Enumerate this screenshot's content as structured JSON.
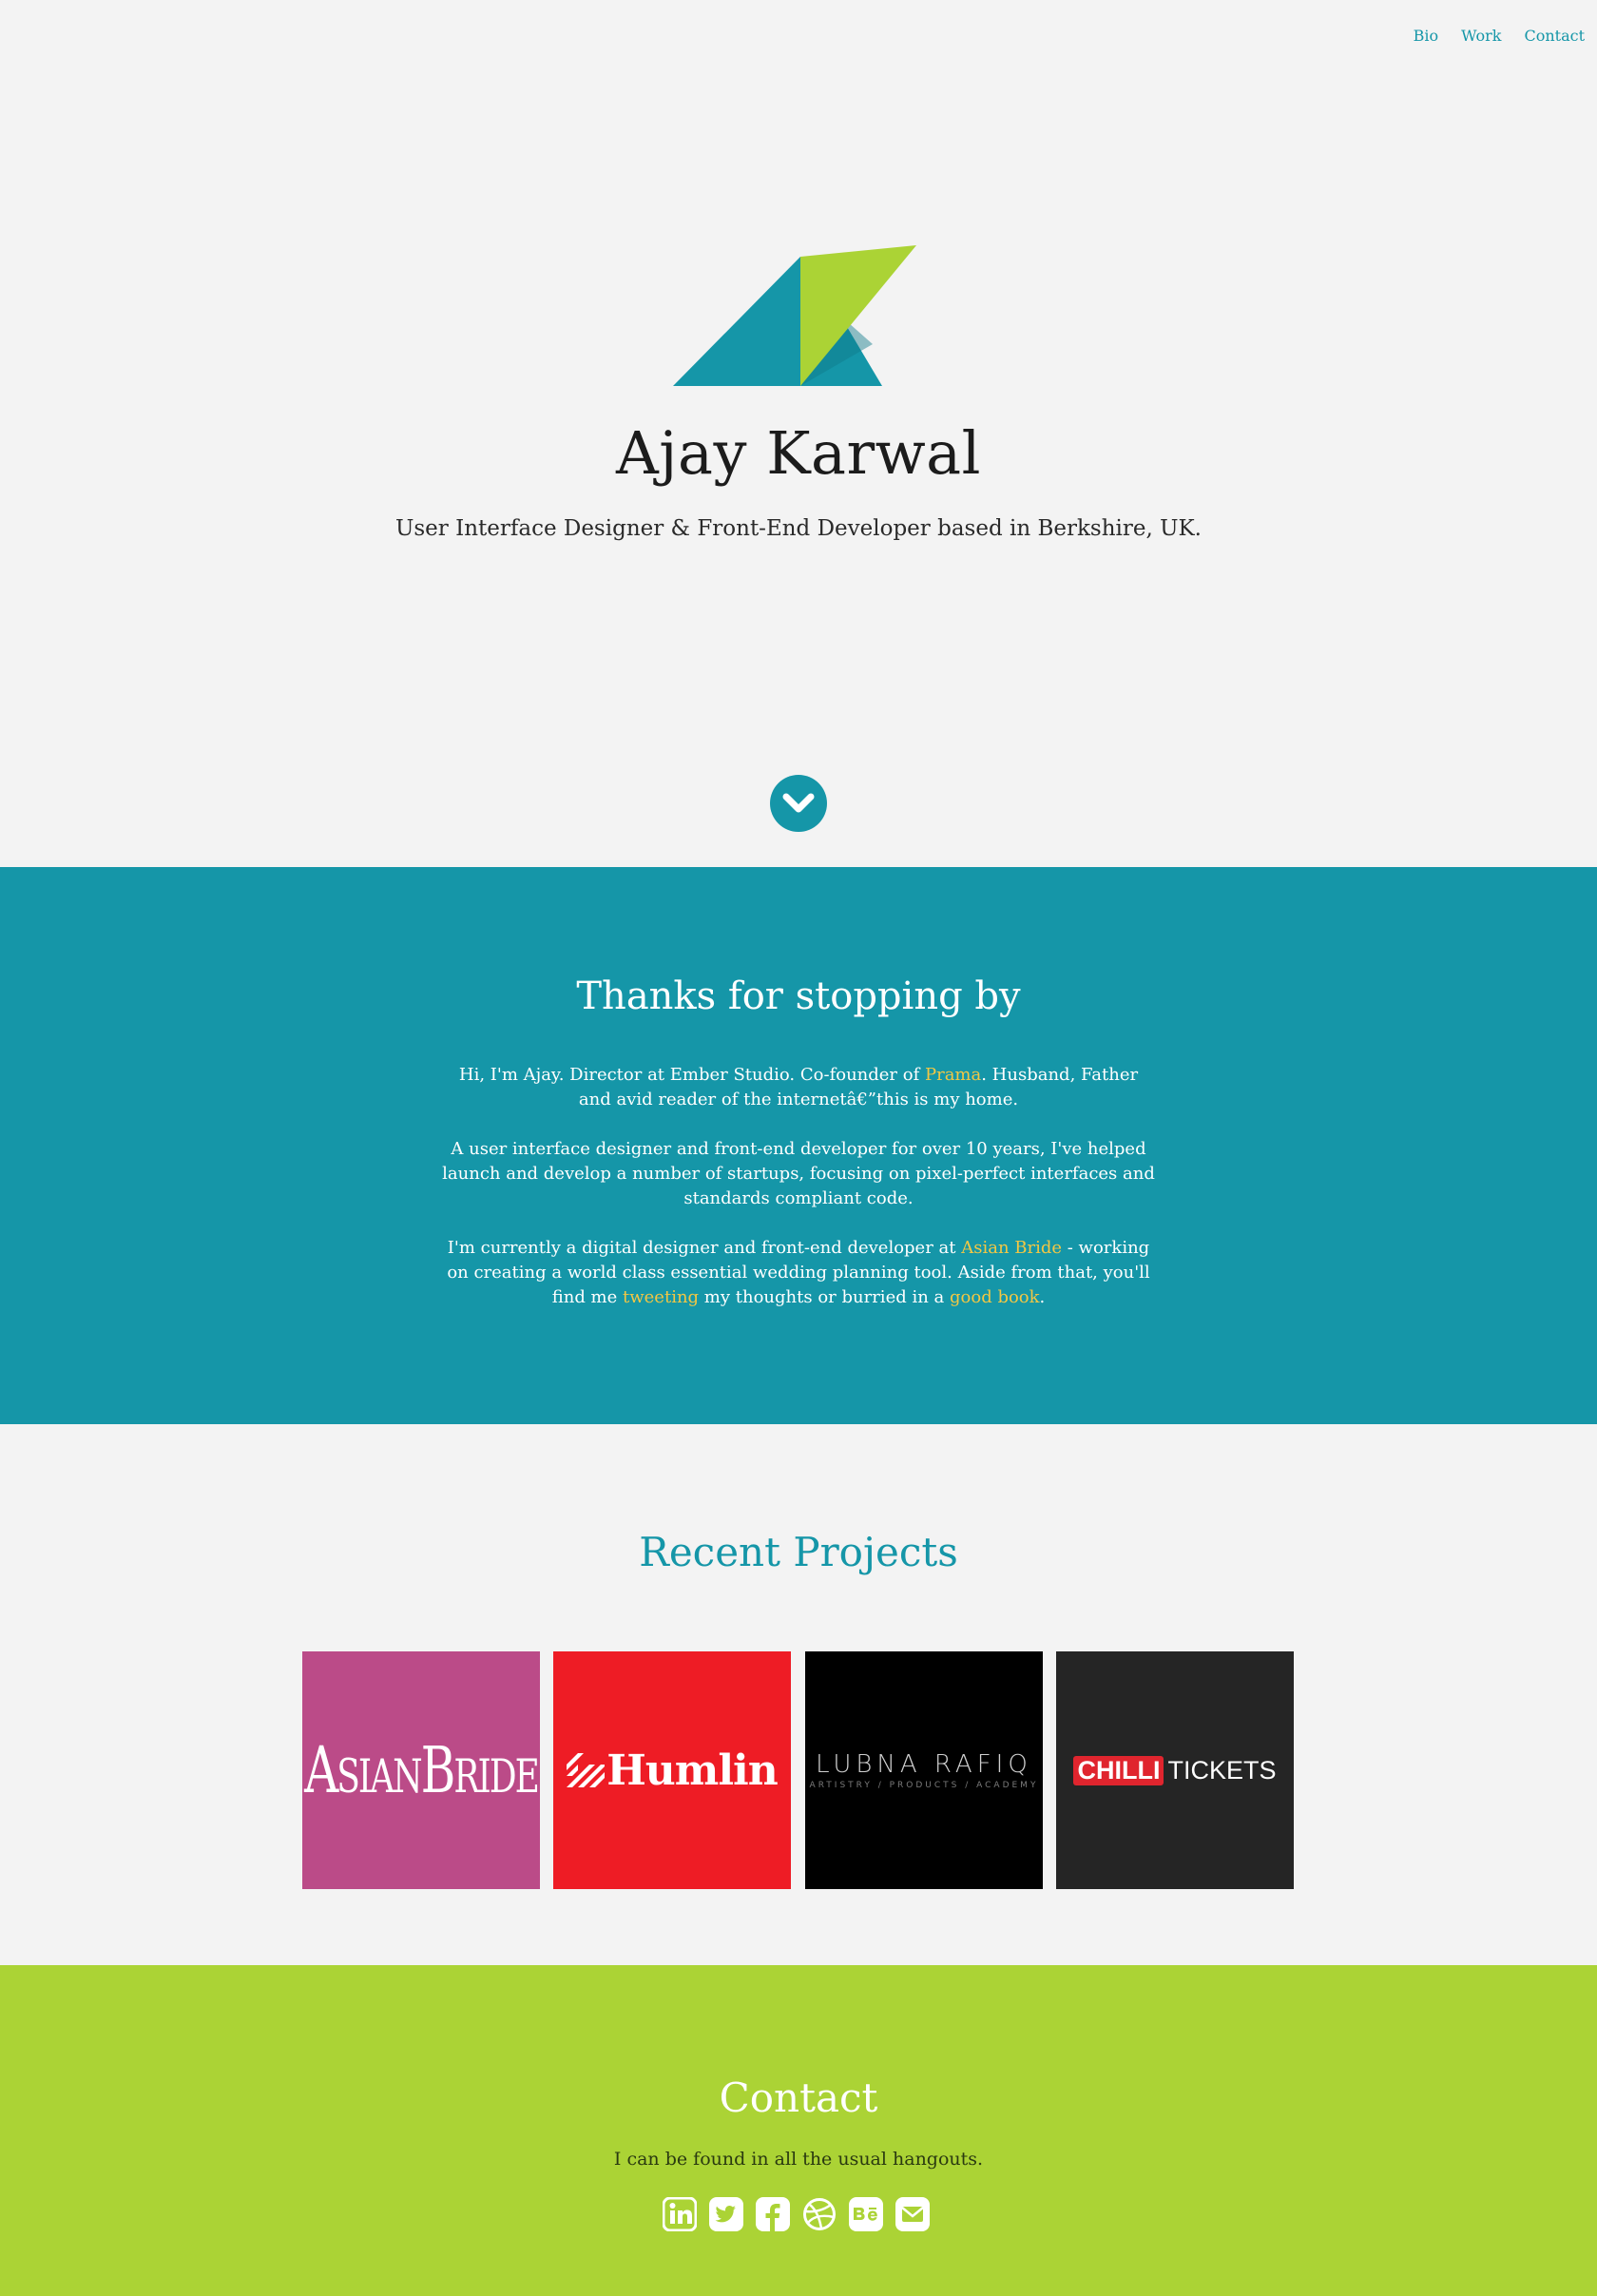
{
  "nav": {
    "items": [
      {
        "label": "Bio"
      },
      {
        "label": "Work"
      },
      {
        "label": "Contact"
      }
    ]
  },
  "hero": {
    "name": "Ajay Karwal",
    "tagline": "User Interface Designer & Front-End Developer based in Berkshire, UK."
  },
  "bio": {
    "title": "Thanks for stopping by",
    "p1_a": "Hi, I'm Ajay. Director at Ember Studio. Co-founder of ",
    "p1_link": "Prama",
    "p1_b": ". Husband, Father and avid reader of the internetâ€”this is my home.",
    "p2": "A user interface designer and front-end developer for over 10 years, I've helped launch and develop a number of startups, focusing on pixel-perfect interfaces and standards compliant code.",
    "p3_a": "I'm currently a digital designer and front-end developer at ",
    "p3_link1": "Asian Bride",
    "p3_b": " - working on creating a world class essential wedding planning tool. Aside from that, you'll find me ",
    "p3_link2": "tweeting",
    "p3_c": " my thoughts or burried in a ",
    "p3_link3": "good book",
    "p3_d": "."
  },
  "projects": {
    "title": "Recent Projects",
    "items": [
      {
        "logo_a": "A",
        "logo_b": "SIAN",
        "logo_c": "B",
        "logo_d": "RIDE",
        "color": "#bb4b88"
      },
      {
        "logo": "Humlin",
        "color": "#ee1c25"
      },
      {
        "logo": "LUBNA RAFIQ",
        "tagline": "ARTISTRY / PRODUCTS / ACADEMY",
        "color": "#000000"
      },
      {
        "logo_a": "CHILLI",
        "logo_b": "TICKETS",
        "color": "#252525"
      }
    ]
  },
  "contact": {
    "title": "Contact",
    "subtitle": "I can be found in all the usual hangouts.",
    "icons": [
      "linkedin-icon",
      "twitter-icon",
      "facebook-icon",
      "dribbble-icon",
      "behance-icon",
      "email-icon"
    ]
  },
  "colors": {
    "teal": "#1596a8",
    "green": "#abd335",
    "link": "#f2c744",
    "background": "#f3f3f3"
  }
}
